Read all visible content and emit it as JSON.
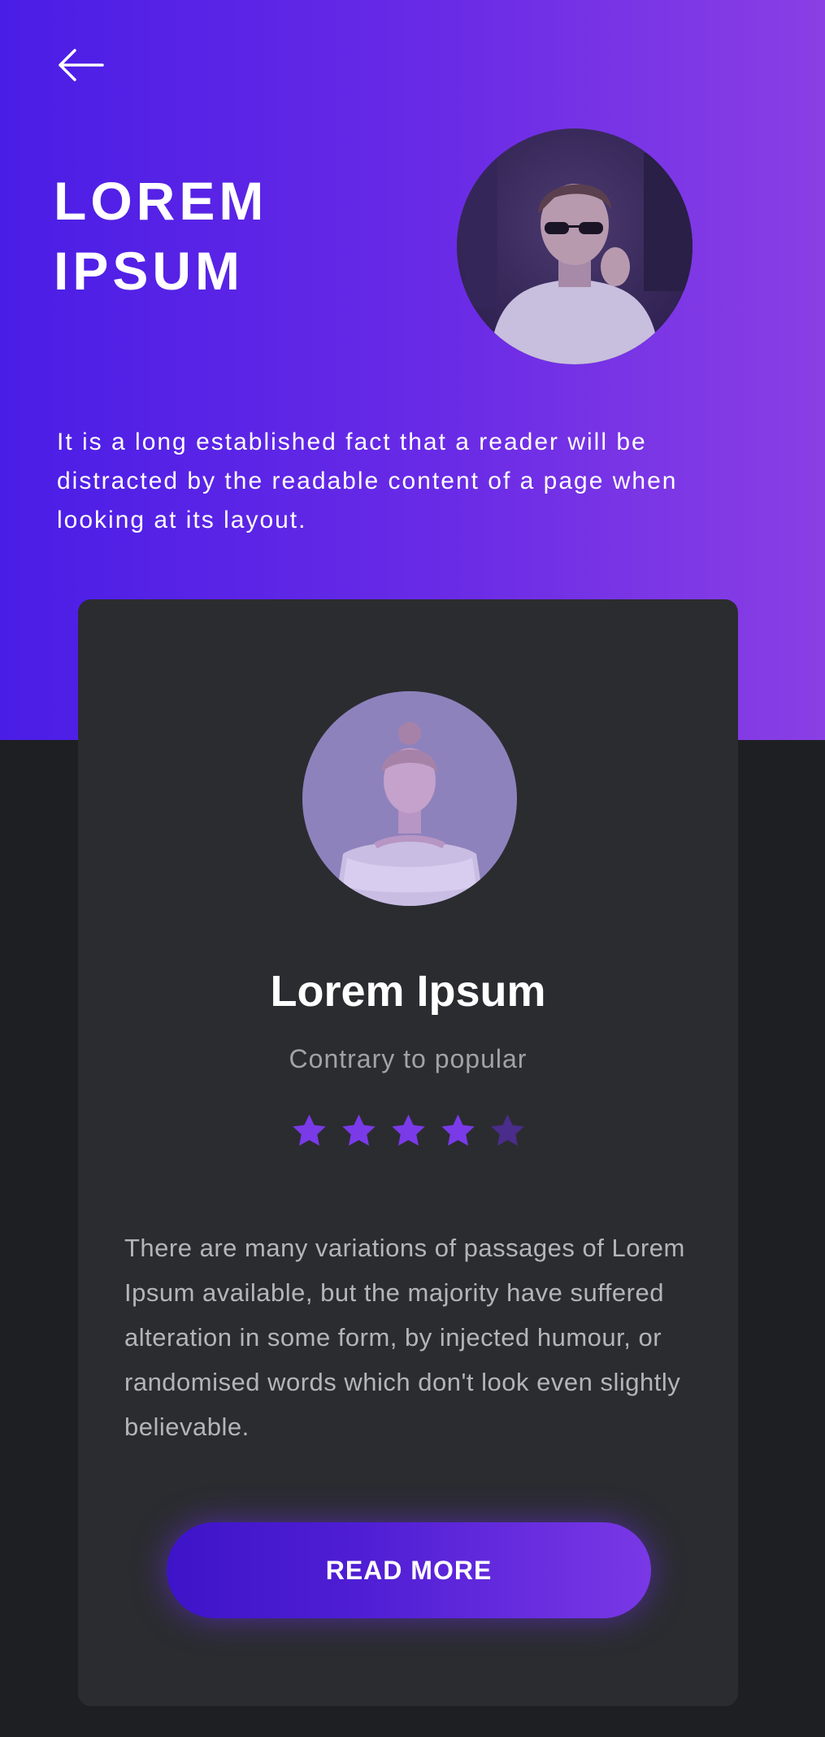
{
  "hero": {
    "title": "LOREM\nIPSUM",
    "description": "It is a long established fact that a reader will be distracted by the readable content of a page when looking at its layout.",
    "avatar_icon": "man-with-sunglasses-photo"
  },
  "nav": {
    "back_icon": "arrow-left-icon"
  },
  "card": {
    "avatar_icon": "woman-portrait-photo",
    "title": "Lorem Ipsum",
    "subtitle": "Contrary to popular",
    "rating": 4,
    "rating_max": 5,
    "body": "There are many variations of passages of Lorem Ipsum available, but the majority have suffered alteration in some form, by injected humour, or randomised words which don't look even slightly believable.",
    "button_label": "READ MORE"
  },
  "colors": {
    "gradient_start": "#4a1de6",
    "gradient_end": "#8a3fe4",
    "background": "#1e1f22",
    "card": "#2b2c30",
    "star_active": "#7a3ae8",
    "star_inactive": "#4a2c8a"
  }
}
